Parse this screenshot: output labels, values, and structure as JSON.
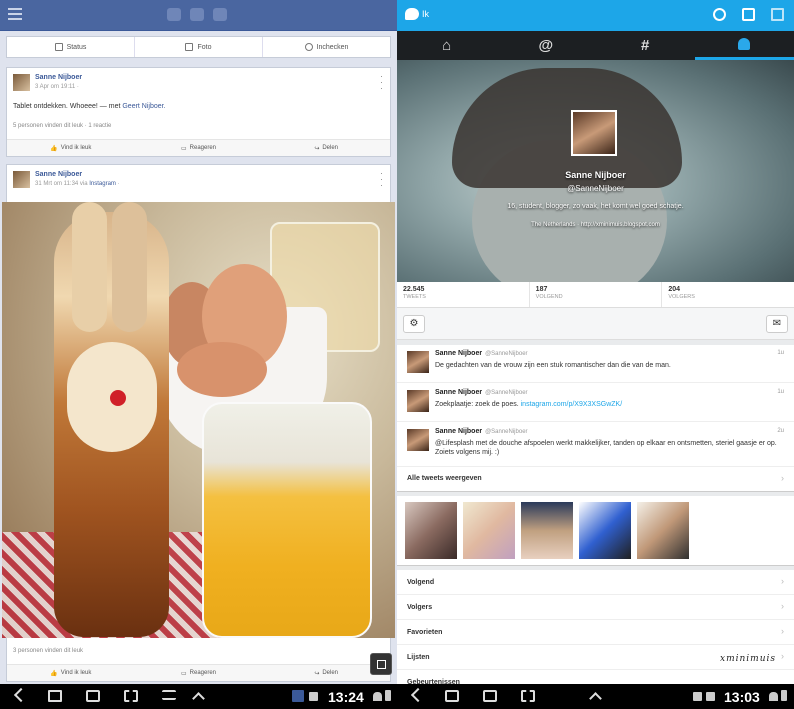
{
  "facebook": {
    "actions": [
      "Status",
      "Foto",
      "Inchecken"
    ],
    "post1": {
      "name": "Sanne Nijboer",
      "meta": "3 Apr om 19:11 ·",
      "text": "Tablet ontdekken. Whoeee!",
      "with_prefix": " — met ",
      "with_name": "Geert Nijboer.",
      "likes": "5 personen vinden dit leuk · 1 reactie"
    },
    "post2": {
      "name": "Sanne Nijboer",
      "meta_prefix": "31 Mrt om 11:34 via ",
      "meta_app": "Instagram",
      "meta_suffix": " ·",
      "likes": "3 personen vinden dit leuk"
    },
    "buttons": [
      "Vind ik leuk",
      "Reageren",
      "Delen"
    ],
    "clock": "13:24"
  },
  "twitter": {
    "title": "Ik",
    "tabs": [
      "home-icon",
      "mention-icon",
      "hashtag-icon",
      "profile-icon"
    ],
    "tab_labels": [
      "⌂",
      "@",
      "#",
      "👤"
    ],
    "profile": {
      "name": "Sanne Nijboer",
      "handle": "@SanneNijboer",
      "bio": "16, student, blogger, zo vaak, het komt wel goed schatje.",
      "location": "The Netherlands · http://xminimuis.blogspot.com"
    },
    "stats": [
      {
        "num": "22.545",
        "label": "TWEETS"
      },
      {
        "num": "187",
        "label": "VOLGEND"
      },
      {
        "num": "204",
        "label": "VOLGERS"
      }
    ],
    "tweets": [
      {
        "name": "Sanne Nijboer",
        "handle": "@SanneNijboer",
        "time": "1u",
        "text": "De gedachten van de vrouw zijn een stuk romantischer dan die van de man.",
        "link": ""
      },
      {
        "name": "Sanne Nijboer",
        "handle": "@SanneNijboer",
        "time": "1u",
        "text": "Zoekplaatje: zoek de poes. ",
        "link": "instagram.com/p/X9X3XSGwZK/"
      },
      {
        "name": "Sanne Nijboer",
        "handle": "@SanneNijboer",
        "time": "2u",
        "text": "@Lifesplash met de douche afspoelen werkt makkelijker, tanden op elkaar en ontsmetten, steriel gaasje er op. Zoiets volgens mij. :)",
        "link": ""
      }
    ],
    "all_tweets": "Alle tweets weergeven",
    "menu": [
      "Volgend",
      "Volgers",
      "Favorieten",
      "Lijsten",
      "Gebeurtenissen"
    ],
    "clock": "13:03",
    "watermark": "xminimuis"
  },
  "colors": {
    "facebook_blue": "#4a66a0",
    "twitter_blue": "#1da6e8"
  }
}
